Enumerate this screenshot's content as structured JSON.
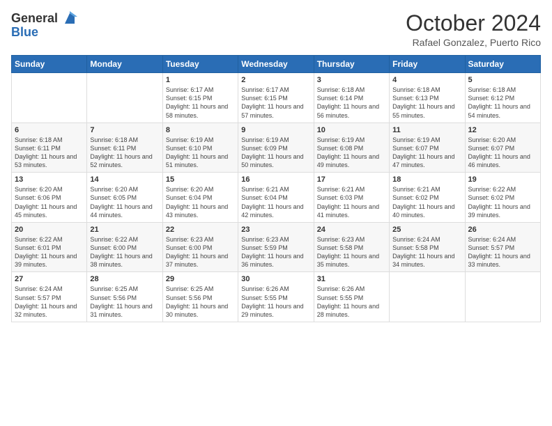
{
  "header": {
    "logo_line1": "General",
    "logo_line2": "Blue",
    "month": "October 2024",
    "location": "Rafael Gonzalez, Puerto Rico"
  },
  "days_of_week": [
    "Sunday",
    "Monday",
    "Tuesday",
    "Wednesday",
    "Thursday",
    "Friday",
    "Saturday"
  ],
  "weeks": [
    [
      {
        "day": "",
        "info": ""
      },
      {
        "day": "",
        "info": ""
      },
      {
        "day": "1",
        "info": "Sunrise: 6:17 AM\nSunset: 6:15 PM\nDaylight: 11 hours and 58 minutes."
      },
      {
        "day": "2",
        "info": "Sunrise: 6:17 AM\nSunset: 6:15 PM\nDaylight: 11 hours and 57 minutes."
      },
      {
        "day": "3",
        "info": "Sunrise: 6:18 AM\nSunset: 6:14 PM\nDaylight: 11 hours and 56 minutes."
      },
      {
        "day": "4",
        "info": "Sunrise: 6:18 AM\nSunset: 6:13 PM\nDaylight: 11 hours and 55 minutes."
      },
      {
        "day": "5",
        "info": "Sunrise: 6:18 AM\nSunset: 6:12 PM\nDaylight: 11 hours and 54 minutes."
      }
    ],
    [
      {
        "day": "6",
        "info": "Sunrise: 6:18 AM\nSunset: 6:11 PM\nDaylight: 11 hours and 53 minutes."
      },
      {
        "day": "7",
        "info": "Sunrise: 6:18 AM\nSunset: 6:11 PM\nDaylight: 11 hours and 52 minutes."
      },
      {
        "day": "8",
        "info": "Sunrise: 6:19 AM\nSunset: 6:10 PM\nDaylight: 11 hours and 51 minutes."
      },
      {
        "day": "9",
        "info": "Sunrise: 6:19 AM\nSunset: 6:09 PM\nDaylight: 11 hours and 50 minutes."
      },
      {
        "day": "10",
        "info": "Sunrise: 6:19 AM\nSunset: 6:08 PM\nDaylight: 11 hours and 49 minutes."
      },
      {
        "day": "11",
        "info": "Sunrise: 6:19 AM\nSunset: 6:07 PM\nDaylight: 11 hours and 47 minutes."
      },
      {
        "day": "12",
        "info": "Sunrise: 6:20 AM\nSunset: 6:07 PM\nDaylight: 11 hours and 46 minutes."
      }
    ],
    [
      {
        "day": "13",
        "info": "Sunrise: 6:20 AM\nSunset: 6:06 PM\nDaylight: 11 hours and 45 minutes."
      },
      {
        "day": "14",
        "info": "Sunrise: 6:20 AM\nSunset: 6:05 PM\nDaylight: 11 hours and 44 minutes."
      },
      {
        "day": "15",
        "info": "Sunrise: 6:20 AM\nSunset: 6:04 PM\nDaylight: 11 hours and 43 minutes."
      },
      {
        "day": "16",
        "info": "Sunrise: 6:21 AM\nSunset: 6:04 PM\nDaylight: 11 hours and 42 minutes."
      },
      {
        "day": "17",
        "info": "Sunrise: 6:21 AM\nSunset: 6:03 PM\nDaylight: 11 hours and 41 minutes."
      },
      {
        "day": "18",
        "info": "Sunrise: 6:21 AM\nSunset: 6:02 PM\nDaylight: 11 hours and 40 minutes."
      },
      {
        "day": "19",
        "info": "Sunrise: 6:22 AM\nSunset: 6:02 PM\nDaylight: 11 hours and 39 minutes."
      }
    ],
    [
      {
        "day": "20",
        "info": "Sunrise: 6:22 AM\nSunset: 6:01 PM\nDaylight: 11 hours and 39 minutes."
      },
      {
        "day": "21",
        "info": "Sunrise: 6:22 AM\nSunset: 6:00 PM\nDaylight: 11 hours and 38 minutes."
      },
      {
        "day": "22",
        "info": "Sunrise: 6:23 AM\nSunset: 6:00 PM\nDaylight: 11 hours and 37 minutes."
      },
      {
        "day": "23",
        "info": "Sunrise: 6:23 AM\nSunset: 5:59 PM\nDaylight: 11 hours and 36 minutes."
      },
      {
        "day": "24",
        "info": "Sunrise: 6:23 AM\nSunset: 5:58 PM\nDaylight: 11 hours and 35 minutes."
      },
      {
        "day": "25",
        "info": "Sunrise: 6:24 AM\nSunset: 5:58 PM\nDaylight: 11 hours and 34 minutes."
      },
      {
        "day": "26",
        "info": "Sunrise: 6:24 AM\nSunset: 5:57 PM\nDaylight: 11 hours and 33 minutes."
      }
    ],
    [
      {
        "day": "27",
        "info": "Sunrise: 6:24 AM\nSunset: 5:57 PM\nDaylight: 11 hours and 32 minutes."
      },
      {
        "day": "28",
        "info": "Sunrise: 6:25 AM\nSunset: 5:56 PM\nDaylight: 11 hours and 31 minutes."
      },
      {
        "day": "29",
        "info": "Sunrise: 6:25 AM\nSunset: 5:56 PM\nDaylight: 11 hours and 30 minutes."
      },
      {
        "day": "30",
        "info": "Sunrise: 6:26 AM\nSunset: 5:55 PM\nDaylight: 11 hours and 29 minutes."
      },
      {
        "day": "31",
        "info": "Sunrise: 6:26 AM\nSunset: 5:55 PM\nDaylight: 11 hours and 28 minutes."
      },
      {
        "day": "",
        "info": ""
      },
      {
        "day": "",
        "info": ""
      }
    ]
  ]
}
